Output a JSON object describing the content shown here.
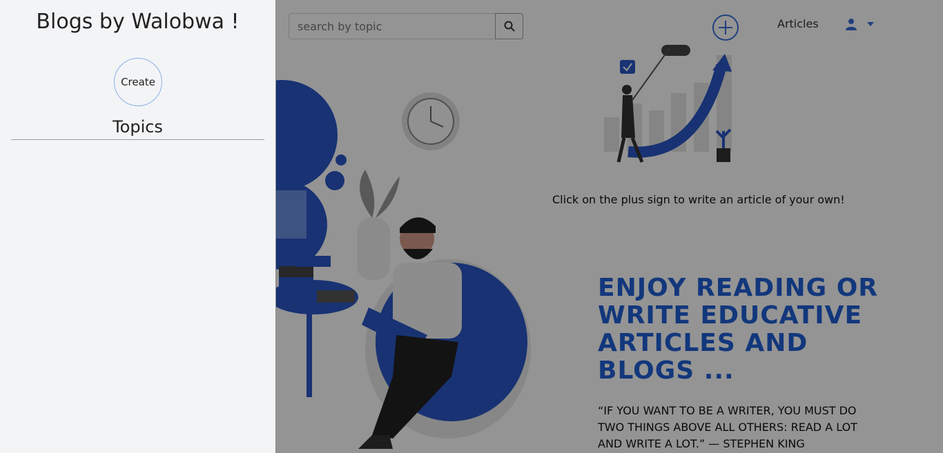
{
  "header": {
    "search": {
      "placeholder": "search by topic",
      "value": ""
    },
    "nav_articles": "Articles"
  },
  "main": {
    "plus_caption": "Click on the plus sign to write an article of your own!",
    "headline": "ENJOY READING OR WRITE EDUCATIVE ARTICLES AND BLOGS ...",
    "quote": "“IF YOU WANT TO BE A WRITER, YOU MUST DO TWO THINGS ABOVE ALL OTHERS: READ A LOT AND WRITE A LOT.” — STEPHEN KING"
  },
  "sidebar": {
    "title": "Blogs by Walobwa !",
    "create_label": "Create",
    "topics_heading": "Topics"
  },
  "icons": {
    "search": "search-icon",
    "plus": "plus-circle-icon",
    "user": "user-icon",
    "caret": "caret-down-icon"
  },
  "colors": {
    "accent": "#1f5fd6",
    "overlay": "rgba(0,0,0,0.42)",
    "sidebar_bg": "#f3f4f6"
  }
}
